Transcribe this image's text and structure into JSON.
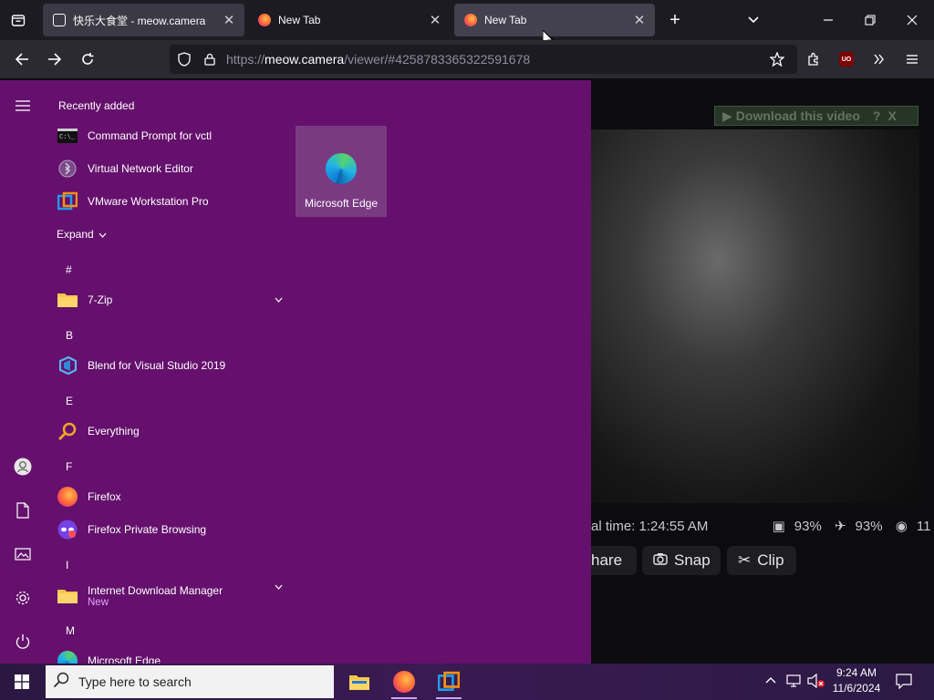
{
  "browser": {
    "tabs": [
      {
        "title": "快乐大食堂 - meow.camera",
        "active": false
      },
      {
        "title": "New Tab",
        "active": false
      },
      {
        "title": "New Tab",
        "active": true
      }
    ],
    "url_scheme": "https://",
    "url_host": "meow.camera",
    "url_path": "/viewer/#4258783365322591678"
  },
  "viewer": {
    "download_label": "Download this video",
    "download_help": "?",
    "download_close": "X",
    "local_time": "al time: 1:24:55 AM",
    "stat_food": "93%",
    "stat_other": "93%",
    "viewers": "11",
    "share_label": "hare",
    "snap_label": "Snap",
    "clip_label": "Clip"
  },
  "start_menu": {
    "recently_added_label": "Recently added",
    "recent": [
      {
        "label": "Command Prompt for vctl",
        "icon": "cmd-icon"
      },
      {
        "label": "Virtual Network Editor",
        "icon": "network-icon"
      },
      {
        "label": "VMware Workstation Pro",
        "icon": "vmware-icon"
      }
    ],
    "expand_label": "Expand",
    "groups": [
      {
        "letter": "#",
        "items": [
          {
            "label": "7-Zip",
            "sub": "",
            "expandable": true,
            "icon": "folder-icon"
          }
        ]
      },
      {
        "letter": "B",
        "items": [
          {
            "label": "Blend for Visual Studio 2019",
            "sub": "",
            "expandable": false,
            "icon": "blend-icon"
          }
        ]
      },
      {
        "letter": "E",
        "items": [
          {
            "label": "Everything",
            "sub": "",
            "expandable": false,
            "icon": "everything-icon"
          }
        ]
      },
      {
        "letter": "F",
        "items": [
          {
            "label": "Firefox",
            "sub": "",
            "expandable": false,
            "icon": "firefox-icon"
          },
          {
            "label": "Firefox Private Browsing",
            "sub": "",
            "expandable": false,
            "icon": "private-browsing-icon"
          }
        ]
      },
      {
        "letter": "I",
        "items": [
          {
            "label": "Internet Download Manager",
            "sub": "New",
            "expandable": true,
            "icon": "folder-icon"
          }
        ]
      },
      {
        "letter": "M",
        "items": [
          {
            "label": "Microsoft Edge",
            "sub": "",
            "expandable": false,
            "icon": "edge-icon"
          }
        ]
      }
    ],
    "tile": {
      "label": "Microsoft Edge"
    }
  },
  "taskbar": {
    "search_placeholder": "Type here to search",
    "time": "9:24 AM",
    "date": "11/6/2024"
  },
  "colors": {
    "start_bg": "#65106d",
    "tile_bg": "#7a3a82",
    "accent_sub": "#e0a4ff"
  }
}
